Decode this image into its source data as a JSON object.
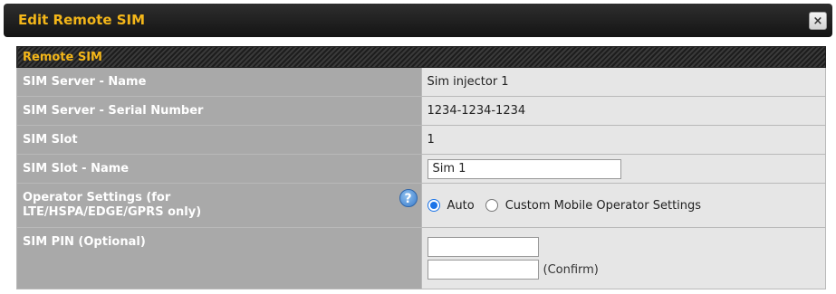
{
  "dialog": {
    "title": "Edit Remote SIM",
    "close_symbol": "×"
  },
  "section": {
    "title": "Remote SIM"
  },
  "rows": {
    "server_name": {
      "label": "SIM Server - Name",
      "value": "Sim injector 1"
    },
    "serial_number": {
      "label": "SIM Server - Serial Number",
      "value": "1234-1234-1234"
    },
    "sim_slot": {
      "label": "SIM Slot",
      "value": "1"
    },
    "slot_name": {
      "label": "SIM Slot - Name",
      "value": "Sim 1"
    },
    "operator": {
      "label_line1": "Operator Settings (for",
      "label_line2": "LTE/HSPA/EDGE/GPRS only)",
      "help_symbol": "?",
      "options": [
        "Auto",
        "Custom Mobile Operator Settings"
      ],
      "selected": "Auto"
    },
    "sim_pin": {
      "label": "SIM PIN (Optional)",
      "value": "",
      "confirm_value": "",
      "confirm_label": "(Confirm)"
    }
  },
  "icons": {
    "close": "close-icon",
    "help": "help-icon"
  },
  "colors": {
    "title_accent": "#f3b619",
    "label_background": "#a9a9a9",
    "value_background": "#e6e6e6",
    "radio_selected": "#1a73e8"
  }
}
